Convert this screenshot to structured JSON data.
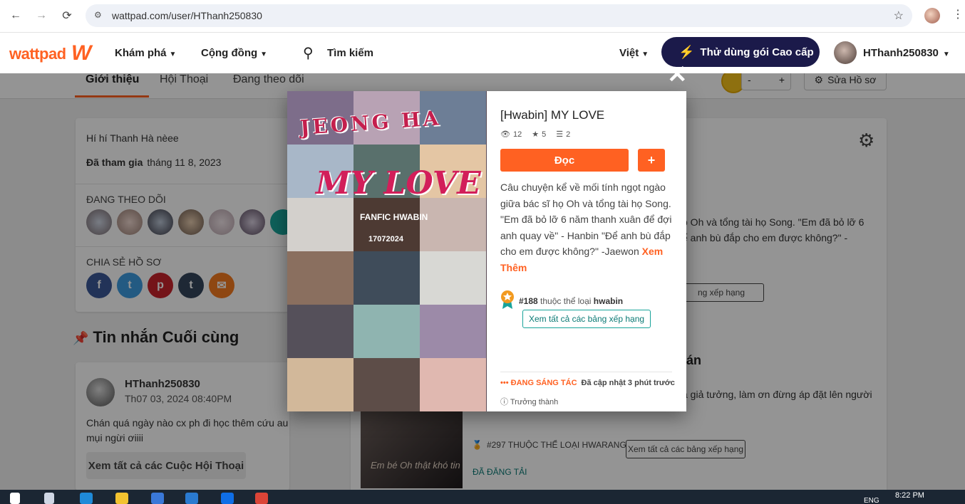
{
  "browser": {
    "url": "wattpad.com/user/HThanh250830",
    "back_icon": "←",
    "forward_icon": "→",
    "reload_icon": "⟳"
  },
  "header": {
    "logo": "wattpad",
    "explore": "Khám phá",
    "community": "Cộng đồng",
    "search": "Tìm kiếm",
    "language": "Việt",
    "premium": "Thử dùng gói Cao cấp",
    "username": "HThanh250830"
  },
  "profile_tabs": [
    "Giới thiệu",
    "Hội Thoại",
    "Đang theo dõi"
  ],
  "profile_actions": {
    "coin_minus": "-",
    "coin_plus": "+",
    "edit_profile": "Sửa Hồ sơ"
  },
  "about": {
    "bio": "Hí hí Thanh Hà nèee",
    "joined_label": "Đã tham gia",
    "joined_date": "tháng 11 8, 2023",
    "following_label": "ĐANG THEO DÕI",
    "share_label": "CHIA SẺ HỒ SƠ"
  },
  "messages": {
    "title": "Tin nhắn Cuối cùng",
    "user": "HThanh250830",
    "time": "Th07 03, 2024 08:40PM",
    "body": "Chán quá ngày nào cx  ph đi học thêm cứu au mụi ngừi ơiiii",
    "view_all": "Xem tất cả các Cuộc Hội Thoại"
  },
  "right_panel": {
    "bg_text1": "ọ Oh và tổng tài họ Song. \"Em đã bỏ lỡ 6",
    "bg_text2": "ể anh bù đắp cho em được không?\" -",
    "bg_rank_btn": "ng xếp hạng",
    "bg_story_title": "tán",
    "bg_story_desc": "à giả tưởng, làm ơn đừng áp đặt lên người",
    "bg_cover_text": "Em bé Oh thật khó tin",
    "bg_rank2": "#297 THUỘC THỂ LOẠI HWARANG",
    "bg_rank2_btn": "Xem tất cả các bảng xếp hạng",
    "bg_published": "ĐÃ ĐĂNG TẢI"
  },
  "modal": {
    "close": "✕",
    "cover_top": "JEONG HA",
    "cover_main": "MY LOVE",
    "cover_sub": "FANFIC HWABIN",
    "cover_date": "17072024",
    "title": "[Hwabin] MY LOVE",
    "reads": "12",
    "votes": "5",
    "parts": "2",
    "read_btn": "Đọc",
    "add_btn": "+",
    "description": "Câu chuyện kể về mối tính ngọt ngào giữa bác sĩ họ Oh và tổng tài họ Song. \"Em đã bỏ lỡ 6 năm thanh xuân để đợi anh quay về\" - Hanbin \"Để anh bù đắp cho em được không?\" -Jaewon",
    "see_more": "Xem Thêm",
    "rank_num": "#188",
    "rank_text": "thuộc thể loại",
    "rank_tag": "hwabin",
    "rank_btn": "Xem tất cả các bảng xếp hạng",
    "status_ongoing": "ĐANG SÁNG TÁC",
    "updated": "Đã cập nhật 3 phút trước",
    "mature": "Trưởng thành"
  },
  "taskbar": {
    "clock": "8:22 PM",
    "lang": "ENG"
  },
  "colors": {
    "accent": "#ff6122",
    "premium_bg": "#1b1a4a",
    "teal": "#18a39a"
  }
}
